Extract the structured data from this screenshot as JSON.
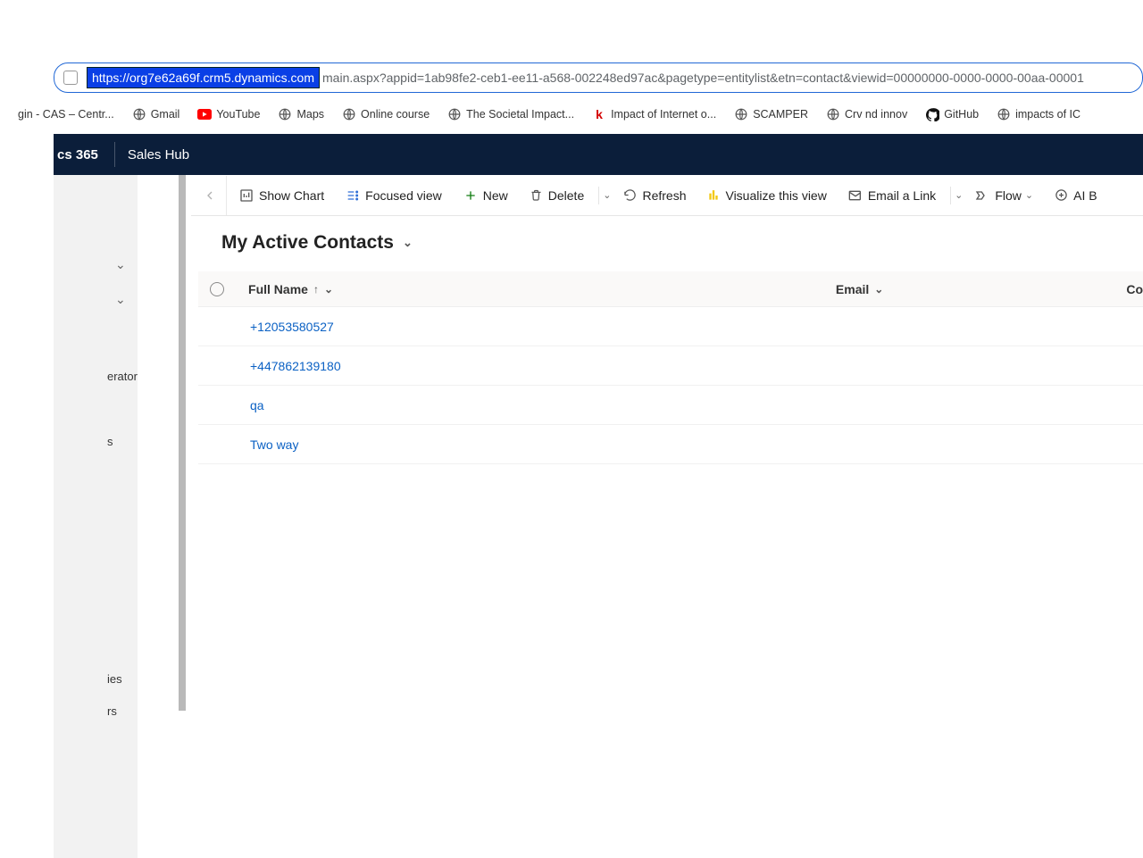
{
  "browser": {
    "url_highlight": "https://org7e62a69f.crm5.dynamics.com",
    "url_rest": "main.aspx?appid=1ab98fe2-ceb1-ee11-a568-002248ed97ac&pagetype=entitylist&etn=contact&viewid=00000000-0000-0000-00aa-00001",
    "bookmarks": [
      {
        "label": "gin - CAS – Centr..."
      },
      {
        "label": "Gmail"
      },
      {
        "label": "YouTube"
      },
      {
        "label": "Maps"
      },
      {
        "label": "Online course"
      },
      {
        "label": "The Societal Impact..."
      },
      {
        "label": "Impact of Internet o..."
      },
      {
        "label": "SCAMPER"
      },
      {
        "label": "Crv nd innov"
      },
      {
        "label": "GitHub"
      },
      {
        "label": "impacts of IC"
      }
    ]
  },
  "app": {
    "name": "cs 365",
    "hub": "Sales Hub"
  },
  "sidebar": {
    "items": [
      "erator",
      "s",
      "ies",
      "rs"
    ]
  },
  "commands": {
    "show_chart": "Show Chart",
    "focused_view": "Focused view",
    "new": "New",
    "delete": "Delete",
    "refresh": "Refresh",
    "visualize": "Visualize this view",
    "email_link": "Email a Link",
    "flow": "Flow",
    "ai": "AI B"
  },
  "view": {
    "name": "My Active Contacts"
  },
  "grid": {
    "columns": [
      "Full Name",
      "Email",
      "Co"
    ],
    "rows": [
      {
        "full_name": "+12053580527"
      },
      {
        "full_name": "+447862139180"
      },
      {
        "full_name": "qa"
      },
      {
        "full_name": "Two way"
      }
    ]
  }
}
